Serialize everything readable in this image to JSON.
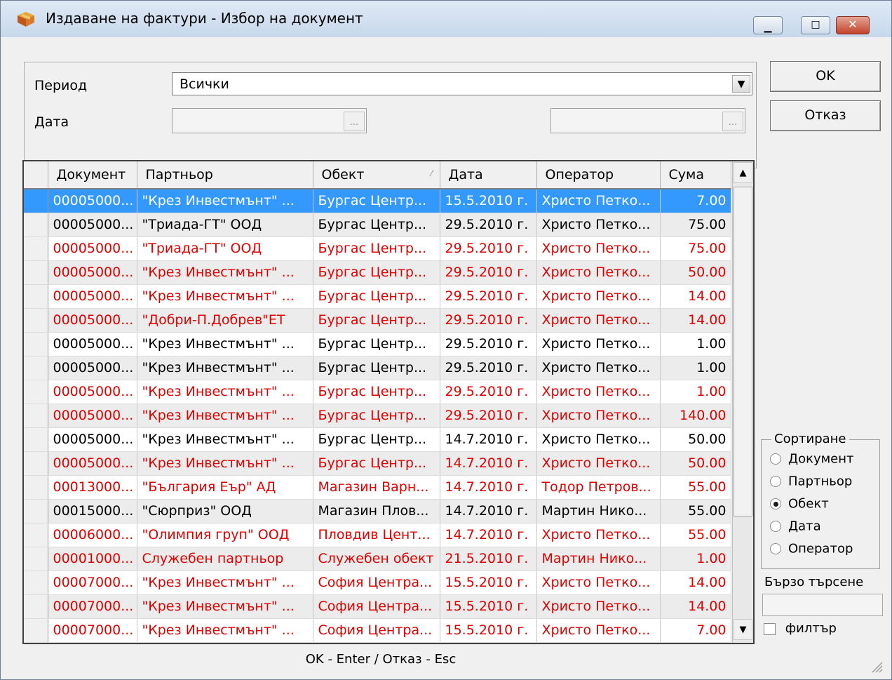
{
  "window": {
    "title": "Издаване на фактури - Избор на документ",
    "icon": "package-icon",
    "controls": {
      "minimize": "▁",
      "maximize": "□",
      "close": "✕"
    }
  },
  "filters": {
    "period_label": "Период",
    "period_value": "Всички",
    "date_label": "Дата",
    "date_from": "",
    "date_to": "",
    "date_button": "..."
  },
  "buttons": {
    "ok": "OK",
    "cancel": "Отказ"
  },
  "grid": {
    "columns": [
      "Документ",
      "Партньор",
      "Обект",
      "Дата",
      "Оператор",
      "Сума"
    ],
    "sorted_column": "Обект",
    "rows": [
      {
        "doc": "00005000...",
        "partner": "\"Крез Инвестмънт\" ...",
        "object": "Бургас Центр...",
        "date": "15.5.2010 г.",
        "operator": "Христо Петко...",
        "sum": "7.00",
        "color": "red",
        "selected": true
      },
      {
        "doc": "00005000...",
        "partner": "\"Триада-ГТ\" ООД",
        "object": "Бургас Центр...",
        "date": "29.5.2010 г.",
        "operator": "Христо Петко...",
        "sum": "75.00",
        "color": "black"
      },
      {
        "doc": "00005000...",
        "partner": "\"Триада-ГТ\" ООД",
        "object": "Бургас Центр...",
        "date": "29.5.2010 г.",
        "operator": "Христо Петко...",
        "sum": "75.00",
        "color": "red"
      },
      {
        "doc": "00005000...",
        "partner": "\"Крез Инвестмънт\" ...",
        "object": "Бургас Центр...",
        "date": "29.5.2010 г.",
        "operator": "Христо Петко...",
        "sum": "50.00",
        "color": "red"
      },
      {
        "doc": "00005000...",
        "partner": "\"Крез Инвестмънт\" ...",
        "object": "Бургас Центр...",
        "date": "29.5.2010 г.",
        "operator": "Христо Петко...",
        "sum": "14.00",
        "color": "red"
      },
      {
        "doc": "00005000...",
        "partner": "\"Добри-П.Добрев\"ЕТ",
        "object": "Бургас Центр...",
        "date": "29.5.2010 г.",
        "operator": "Христо Петко...",
        "sum": "14.00",
        "color": "red"
      },
      {
        "doc": "00005000...",
        "partner": "\"Крез Инвестмънт\" ...",
        "object": "Бургас Центр...",
        "date": "29.5.2010 г.",
        "operator": "Христо Петко...",
        "sum": "1.00",
        "color": "black"
      },
      {
        "doc": "00005000...",
        "partner": "\"Крез Инвестмънт\" ...",
        "object": "Бургас Центр...",
        "date": "29.5.2010 г.",
        "operator": "Христо Петко...",
        "sum": "1.00",
        "color": "black"
      },
      {
        "doc": "00005000...",
        "partner": "\"Крез Инвестмънт\" ...",
        "object": "Бургас Центр...",
        "date": "29.5.2010 г.",
        "operator": "Христо Петко...",
        "sum": "1.00",
        "color": "red"
      },
      {
        "doc": "00005000...",
        "partner": "\"Крез Инвестмънт\" ...",
        "object": "Бургас Центр...",
        "date": "29.5.2010 г.",
        "operator": "Христо Петко...",
        "sum": "140.00",
        "color": "red"
      },
      {
        "doc": "00005000...",
        "partner": "\"Крез Инвестмънт\" ...",
        "object": "Бургас Центр...",
        "date": "14.7.2010 г.",
        "operator": "Христо Петко...",
        "sum": "50.00",
        "color": "black"
      },
      {
        "doc": "00005000...",
        "partner": "\"Крез Инвестмънт\" ...",
        "object": "Бургас Центр...",
        "date": "14.7.2010 г.",
        "operator": "Христо Петко...",
        "sum": "50.00",
        "color": "red"
      },
      {
        "doc": "00013000...",
        "partner": "\"България Еър\" АД",
        "object": "Магазин Варн...",
        "date": "14.7.2010 г.",
        "operator": "Тодор Петров...",
        "sum": "55.00",
        "color": "red"
      },
      {
        "doc": "00015000...",
        "partner": "\"Сюрприз\" ООД",
        "object": "Магазин Плов...",
        "date": "14.7.2010 г.",
        "operator": "Мартин Нико...",
        "sum": "55.00",
        "color": "black"
      },
      {
        "doc": "00006000...",
        "partner": "\"Олимпия груп\" ООД",
        "object": "Пловдив Цент...",
        "date": "14.7.2010 г.",
        "operator": "Христо Петко...",
        "sum": "55.00",
        "color": "red"
      },
      {
        "doc": "00001000...",
        "partner": "Служебен партньор",
        "object": "Служебен обект",
        "date": "21.5.2010 г.",
        "operator": "Мартин Нико...",
        "sum": "1.00",
        "color": "red"
      },
      {
        "doc": "00007000...",
        "partner": "\"Крез Инвестмънт\" ...",
        "object": "София Центра...",
        "date": "15.5.2010 г.",
        "operator": "Христо Петко...",
        "sum": "14.00",
        "color": "red"
      },
      {
        "doc": "00007000...",
        "partner": "\"Крез Инвестмънт\" ...",
        "object": "София Центра...",
        "date": "15.5.2010 г.",
        "operator": "Христо Петко...",
        "sum": "14.00",
        "color": "red"
      },
      {
        "doc": "00007000...",
        "partner": "\"Крез Инвестмънт\" ...",
        "object": "София Центра...",
        "date": "15.5.2010 г.",
        "operator": "Христо Петко...",
        "sum": "7.00",
        "color": "red"
      }
    ]
  },
  "sorting": {
    "legend": "Сортиране",
    "options": [
      "Документ",
      "Партньор",
      "Обект",
      "Дата",
      "Оператор"
    ],
    "selected": "Обект"
  },
  "quick_search": {
    "label": "Бързо търсене",
    "value": ""
  },
  "filter_checkbox": {
    "label": "филтър",
    "checked": false
  },
  "status": {
    "hint": "OK - Enter / Отказ - Esc"
  },
  "colors": {
    "selection": "#3399ff",
    "red_text": "#e00000",
    "alt_row": "#ececec"
  }
}
